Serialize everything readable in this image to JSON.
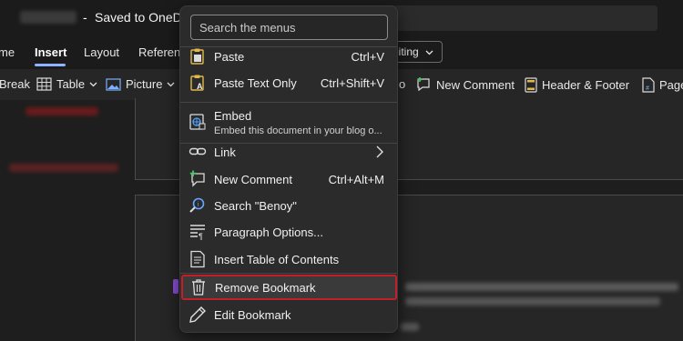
{
  "titlebar": {
    "dash": "-",
    "saved": "Saved to OneDrive"
  },
  "tabs": [
    {
      "label": "me"
    },
    {
      "label": "Insert"
    },
    {
      "label": "Layout"
    },
    {
      "label": "Referen"
    }
  ],
  "editing_button": {
    "label": "diting",
    "icon": "chevron-down-icon"
  },
  "toolbar": {
    "break": "Break",
    "table": "Table",
    "picture": "Picture",
    "partial": "o",
    "new_comment": "New Comment",
    "header_footer": "Header & Footer",
    "page": "Page"
  },
  "menu": {
    "search_placeholder": "Search the menus",
    "items": [
      {
        "label": "Paste",
        "shortcut": "Ctrl+V",
        "icon": "paste-icon"
      },
      {
        "label": "Paste Text Only",
        "shortcut": "Ctrl+Shift+V",
        "icon": "paste-text-only-icon"
      },
      {
        "label": "Embed",
        "sublabel": "Embed this document in your blog o...",
        "icon": "embed-icon"
      },
      {
        "label": "Link",
        "icon": "link-icon",
        "submenu": "chevron-right-icon"
      },
      {
        "label": "New Comment",
        "shortcut": "Ctrl+Alt+M",
        "icon": "new-comment-icon"
      },
      {
        "label": "Search \"Benoy\"",
        "icon": "search-icon"
      },
      {
        "label": "Paragraph Options...",
        "icon": "paragraph-icon"
      },
      {
        "label": "Insert Table of Contents",
        "icon": "table-of-contents-icon"
      },
      {
        "label": "Remove Bookmark",
        "icon": "trash-icon",
        "highlighted": true
      },
      {
        "label": "Edit Bookmark",
        "icon": "pencil-icon"
      }
    ]
  },
  "colors": {
    "highlight_border": "#c21f2a",
    "accent": "#8fb3ff",
    "paste_icon": "#e2b84a",
    "comment_icon": "#4fc36b",
    "search_icon": "#6aa6ff"
  }
}
